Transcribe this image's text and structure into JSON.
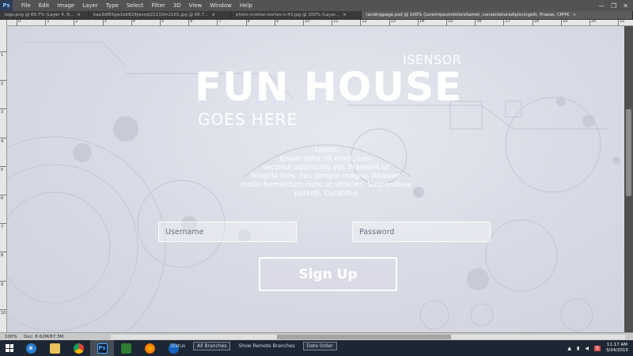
{
  "app": {
    "logo": "Ps"
  },
  "menu": [
    "File",
    "Edit",
    "Image",
    "Layer",
    "Type",
    "Select",
    "Filter",
    "3D",
    "View",
    "Window",
    "Help"
  ],
  "window_controls": [
    "—",
    "❐",
    "✕"
  ],
  "tabs": [
    {
      "label": "logo.png @ 66.7% (Layer 4, R...",
      "close": "×"
    },
    {
      "label": "kaa3df83gw1eb829jwsxdj21110m2101.jpg @ 66.7...",
      "close": "×"
    },
    {
      "label": "photo-cristian-bortes-n-43.jpg @ 100% (Layer...",
      "close": "×"
    },
    {
      "label": "landingpage.psd @ 100% (Loremipsumdolorsitamet, consecteturadipiscingelit. Praese, CMYK",
      "close": "×"
    }
  ],
  "ruler_top": [
    "0",
    "1",
    "2",
    "3",
    "4",
    "5",
    "6",
    "7",
    "8",
    "9",
    "10",
    "11",
    "12",
    "13",
    "14",
    "15",
    "16",
    "17",
    "18",
    "19",
    "20",
    "21"
  ],
  "ruler_left": [
    "1",
    "2",
    "3",
    "4",
    "5",
    "6",
    "7",
    "8",
    "9",
    "10"
  ],
  "canvas": {
    "title_top": "ISENSOR",
    "title_main": "FUN HOUSE",
    "title_sub": "GOES  HERE",
    "arc_lines": [
      "Lorem",
      "ipsum dolor sit amet, con-",
      "sectetur adipiscing elit. Praesent ut",
      "fringilla felis, nec tempor magna. Aliquam",
      "mollis fermentum nunc ut ultricies. Suspendisse",
      "potenti. Curabitur"
    ],
    "username_placeholder": "Username",
    "password_placeholder": "Password",
    "signup_label": "Sign Up"
  },
  "status": {
    "zoom": "100%",
    "doc_size": "Doc: 8.62M/87.3M"
  },
  "background_app": {
    "label_1": "All Branches",
    "label_2": "Show Remote Branches",
    "label_3": "Date Order",
    "label_4": "Status"
  },
  "taskbar": {
    "icons": [
      "windows-start-icon",
      "ie-icon",
      "file-explorer-icon",
      "chrome-icon",
      "photoshop-icon",
      "chart-app-icon",
      "firefox-icon",
      "sourcetree-icon"
    ],
    "clock_time": "11:17 AM",
    "clock_date": "3/24/2015"
  },
  "colors": {
    "menubar": "#535353",
    "taskbar": "#1d2733",
    "canvas_bg": "#d9dbe6",
    "text_white": "#ffffff"
  }
}
